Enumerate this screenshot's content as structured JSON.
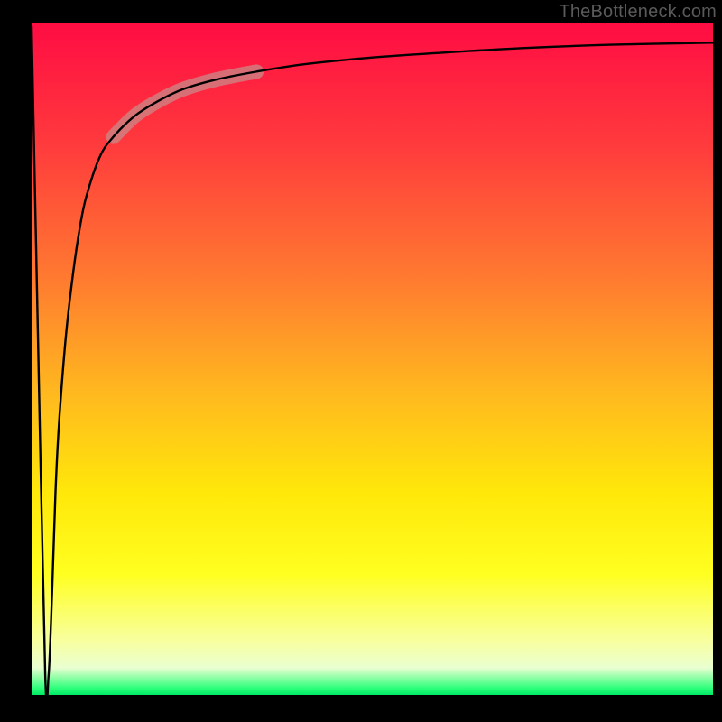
{
  "attribution": "TheBottleneck.com",
  "chart_data": {
    "type": "line",
    "title": "",
    "xlabel": "",
    "ylabel": "",
    "xlim": [
      0,
      100
    ],
    "ylim": [
      0,
      100
    ],
    "grid": false,
    "legend": false,
    "series": [
      {
        "name": "bottleneck-curve",
        "x": [
          0,
          1,
          2,
          2.5,
          3,
          3.5,
          4,
          5,
          6,
          7,
          8,
          10,
          12,
          15,
          18,
          22,
          27,
          33,
          40,
          50,
          60,
          72,
          85,
          100
        ],
        "values": [
          99.5,
          50,
          3,
          3,
          15,
          30,
          40,
          53,
          62,
          69,
          74,
          80,
          83,
          86,
          88,
          90,
          91.5,
          92.7,
          93.8,
          94.8,
          95.5,
          96.2,
          96.7,
          97.0
        ]
      }
    ],
    "highlight_segment": {
      "x_from": 15,
      "x_to": 27
    },
    "gradient_stops": [
      {
        "pos": 0.0,
        "color": "#ff0c43"
      },
      {
        "pos": 0.18,
        "color": "#ff3a3d"
      },
      {
        "pos": 0.38,
        "color": "#ff7a30"
      },
      {
        "pos": 0.55,
        "color": "#ffb81f"
      },
      {
        "pos": 0.7,
        "color": "#ffe80a"
      },
      {
        "pos": 0.82,
        "color": "#ffff20"
      },
      {
        "pos": 0.92,
        "color": "#f8ffa0"
      },
      {
        "pos": 0.96,
        "color": "#e9ffd0"
      },
      {
        "pos": 0.99,
        "color": "#2cff7a"
      },
      {
        "pos": 1.0,
        "color": "#00e865"
      }
    ]
  }
}
